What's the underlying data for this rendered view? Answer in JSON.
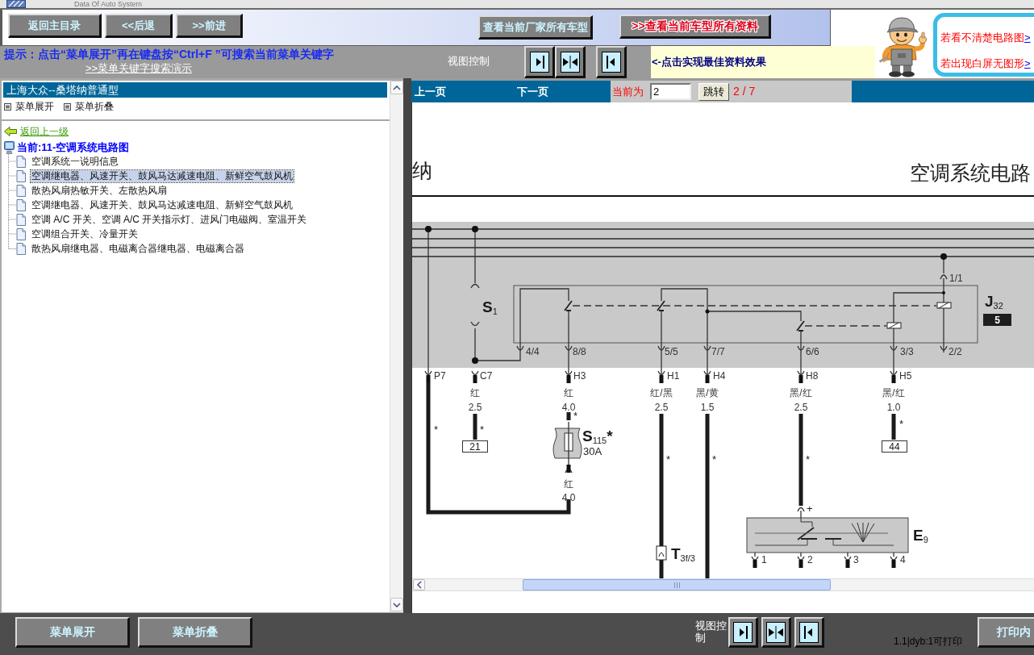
{
  "app_title": {
    "text": "Data Of Auto System"
  },
  "toolbar": {
    "nav_buttons": [
      "返回主目录",
      "<<后退",
      ">>前进"
    ],
    "model_buttons": [
      {
        "kind": "plain",
        "label": "查看当前厂家所有车型"
      },
      {
        "kind": "highlight",
        "prefix": ">>",
        "label": "查看当前车型所有资料"
      }
    ]
  },
  "hint": {
    "text": "提示：点击“菜单展开”再在键盘按“Ctrl+F ”可搜索当前菜单关键字",
    "link": ">>菜单关键字搜索演示"
  },
  "view_control": {
    "label": "视图控制",
    "note": "<-点击实现最佳资料效果"
  },
  "help_box": {
    "lines": [
      {
        "text": "若看不清楚电路图",
        "link": ">"
      },
      {
        "text": "若出现白屏无图形",
        "link": ">"
      }
    ]
  },
  "menu_panel": {
    "title": "上海大众--桑塔纳普通型",
    "actions": [
      "菜单展开",
      "菜单折叠"
    ],
    "back_link": "返回上一级",
    "current": "当前:11-空调系统电路图",
    "items": [
      {
        "label": "空调系统一说明信息",
        "selected": false
      },
      {
        "label": "空调继电器、风速开关、鼓风马达减速电阻、新鲜空气鼓风机",
        "selected": true
      },
      {
        "label": "散热风扇热敏开关、左散热风扇",
        "selected": false
      },
      {
        "label": "空调继电器、风速开关、鼓风马达减速电阻、新鲜空气鼓风机",
        "selected": false
      },
      {
        "label": "空调 A/C 开关、空调 A/C 开关指示灯、进风门电磁阀、室温开关",
        "selected": false
      },
      {
        "label": "空调组合开关、冷量开关",
        "selected": false
      },
      {
        "label": "散热风扇继电器、电磁离合器继电器、电磁离合器",
        "selected": false
      }
    ]
  },
  "viewer": {
    "prev": "上一页",
    "next": "下一页",
    "page_label": "当前为",
    "page_input": "2",
    "go_button": "跳转",
    "page_count": "2 / 7"
  },
  "diagram": {
    "labels": [
      {
        "text": "纳",
        "kind": "title"
      },
      {
        "text": "空调系统电路",
        "kind": "title"
      },
      {
        "text": "1/1",
        "kind": "pin"
      },
      {
        "text": "S$_{1}$",
        "kind": "component"
      },
      {
        "text": "J$_{32}$",
        "kind": "component"
      },
      {
        "text": "5",
        "kind": "badge"
      },
      {
        "text": "4/4",
        "kind": "pin"
      },
      {
        "text": "8/8",
        "kind": "pin"
      },
      {
        "text": "5/5",
        "kind": "pin"
      },
      {
        "text": "7/7",
        "kind": "pin"
      },
      {
        "text": "6/6",
        "kind": "pin"
      },
      {
        "text": "3/3",
        "kind": "pin"
      },
      {
        "text": "2/2",
        "kind": "pin"
      },
      {
        "text": "P7",
        "kind": "pin"
      },
      {
        "text": "C7",
        "kind": "pin"
      },
      {
        "text": "H3",
        "kind": "pin"
      },
      {
        "text": "H1",
        "kind": "pin"
      },
      {
        "text": "H4",
        "kind": "pin"
      },
      {
        "text": "H8",
        "kind": "pin"
      },
      {
        "text": "H5",
        "kind": "pin"
      },
      {
        "text": "红",
        "kind": "wire"
      },
      {
        "text": "2.5",
        "kind": "wire"
      },
      {
        "text": "红",
        "kind": "wire"
      },
      {
        "text": "4.0",
        "kind": "wire"
      },
      {
        "text": "红/黑",
        "kind": "wire"
      },
      {
        "text": "2.5",
        "kind": "wire"
      },
      {
        "text": "黑/黄",
        "kind": "wire"
      },
      {
        "text": "1.5",
        "kind": "wire"
      },
      {
        "text": "黑/红",
        "kind": "wire"
      },
      {
        "text": "2.5",
        "kind": "wire"
      },
      {
        "text": "黑/红",
        "kind": "wire"
      },
      {
        "text": "1.0",
        "kind": "wire"
      },
      {
        "text": "*",
        "kind": "note"
      },
      {
        "text": "*",
        "kind": "note"
      },
      {
        "text": "*",
        "kind": "note"
      },
      {
        "text": "*",
        "kind": "note"
      },
      {
        "text": "21",
        "kind": "box"
      },
      {
        "text": "44",
        "kind": "box"
      },
      {
        "text": "S$_{115}$*",
        "kind": "component"
      },
      {
        "text": "30A",
        "kind": "note"
      },
      {
        "text": "*",
        "kind": "note"
      },
      {
        "text": "*",
        "kind": "note"
      },
      {
        "text": "*",
        "kind": "note"
      },
      {
        "text": "红",
        "kind": "wire"
      },
      {
        "text": "4.0",
        "kind": "wire"
      },
      {
        "text": "+",
        "kind": "note"
      },
      {
        "text": "E$_{9}$",
        "kind": "component"
      },
      {
        "text": "T$_{3f/3}$",
        "kind": "component"
      },
      {
        "text": "1",
        "kind": "pin"
      },
      {
        "text": "2",
        "kind": "pin"
      },
      {
        "text": "3",
        "kind": "pin"
      },
      {
        "text": "4",
        "kind": "pin"
      }
    ]
  },
  "footer": {
    "buttons": [
      "菜单展开",
      "菜单折叠"
    ],
    "view_label": "视图控制",
    "print_status": "1.1|dyb:1可打印",
    "print_button": "打印内"
  }
}
